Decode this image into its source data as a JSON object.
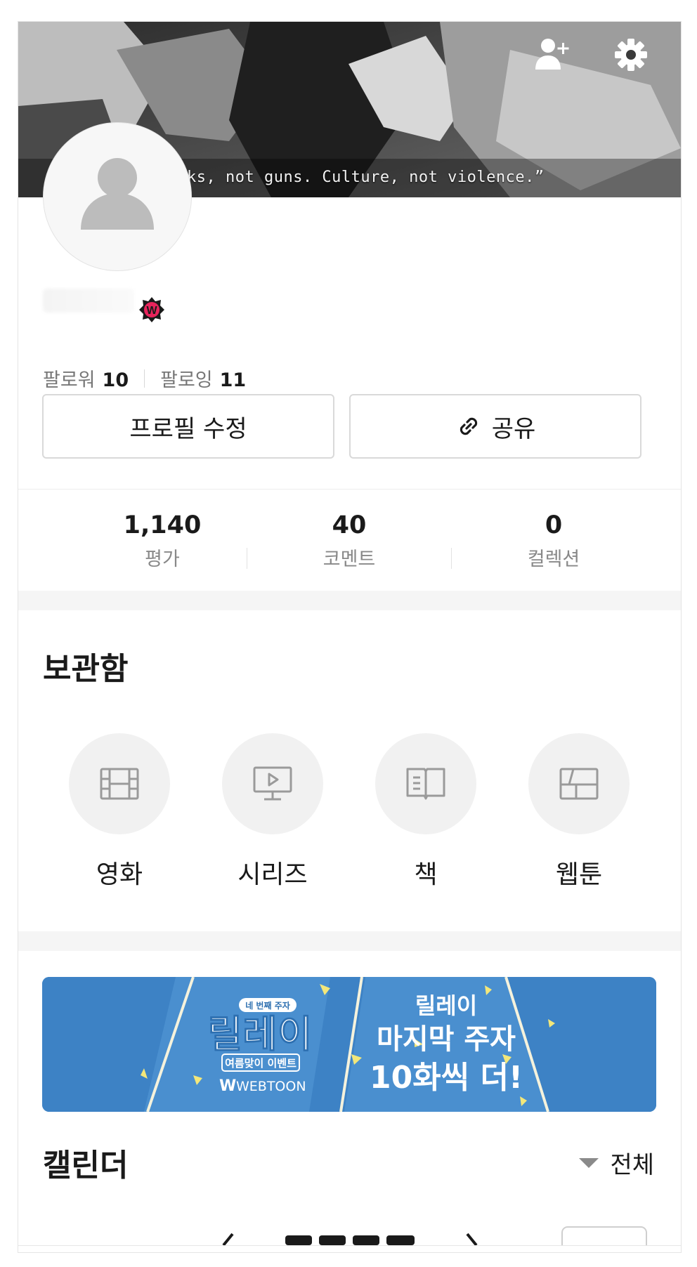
{
  "cover": {
    "quote": "ks, not guns. Culture, not violence.”",
    "add_friend_icon": "person-plus-icon",
    "settings_icon": "gear-icon"
  },
  "profile": {
    "avatar_icon": "person-silhouette-icon",
    "badge_letter": "W",
    "followers_label": "팔로워",
    "followers_count": "10",
    "following_label": "팔로잉",
    "following_count": "11",
    "edit_button": "프로필 수정",
    "share_button": "공유",
    "share_icon": "link-icon"
  },
  "stats": [
    {
      "value": "1,140",
      "label": "평가"
    },
    {
      "value": "40",
      "label": "코멘트"
    },
    {
      "value": "0",
      "label": "컬렉션"
    }
  ],
  "storage": {
    "title": "보관함",
    "items": [
      {
        "label": "영화",
        "icon": "film-icon"
      },
      {
        "label": "시리즈",
        "icon": "tv-play-icon"
      },
      {
        "label": "책",
        "icon": "book-icon"
      },
      {
        "label": "웹툰",
        "icon": "webtoon-panel-icon"
      }
    ]
  },
  "banner": {
    "tag": "네 번째 주자",
    "title_left": "릴레이",
    "subtitle_left": "여름맞이 이벤트",
    "brand": "WEBTOON",
    "line1": "릴레이",
    "line2": "마지막 주자",
    "line3": "10화씩 더!"
  },
  "calendar": {
    "title": "캘린더",
    "filter": "전체"
  },
  "colors": {
    "banner_blue": "#3d82c5",
    "badge_pink": "#e8245c",
    "nav_dot": "#f5a623"
  }
}
